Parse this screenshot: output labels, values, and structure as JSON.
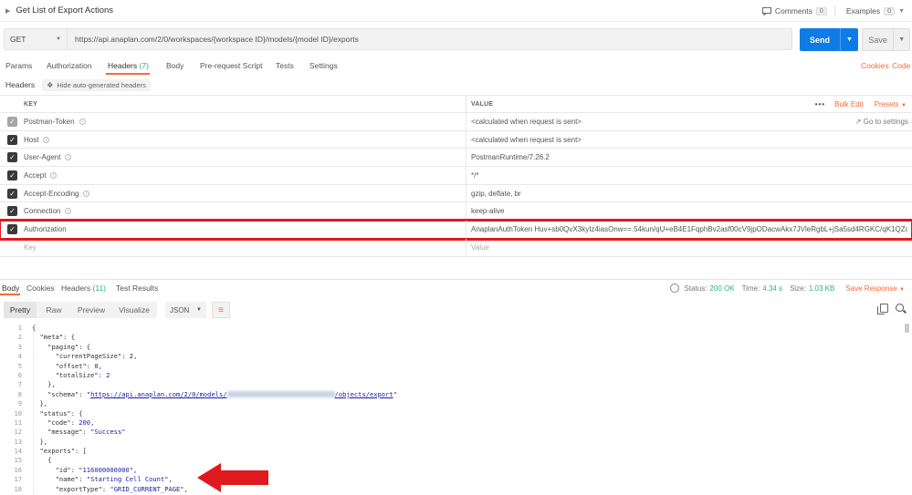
{
  "request": {
    "name": "Get List of Export Actions",
    "method": "GET",
    "url": "https://api.anaplan.com/2/0/workspaces/{workspace ID}/models/{model ID}/exports",
    "send_label": "Send",
    "save_label": "Save"
  },
  "topbar": {
    "comments_label": "Comments",
    "comments_count": "0",
    "examples_label": "Examples",
    "examples_count": "0"
  },
  "request_tabs": {
    "params": "Params",
    "authorization": "Authorization",
    "headers": "Headers",
    "headers_count": "(7)",
    "body": "Body",
    "prerequest": "Pre-request Script",
    "tests": "Tests",
    "settings": "Settings",
    "cookies": "Cookies",
    "code": "Code"
  },
  "headers_section": {
    "label": "Headers",
    "hide_auto": "Hide auto-generated headers",
    "key_col": "KEY",
    "value_col": "VALUE",
    "bulk_edit": "Bulk Edit",
    "presets": "Presets",
    "goto_settings": "Go to settings",
    "key_placeholder": "Key",
    "value_placeholder": "Value",
    "rows": [
      {
        "key": "Postman-Token",
        "value": "<calculated when request is sent>"
      },
      {
        "key": "Host",
        "value": "<calculated when request is sent>"
      },
      {
        "key": "User-Agent",
        "value": "PostmanRuntime/7.26.2"
      },
      {
        "key": "Accept",
        "value": "*/*"
      },
      {
        "key": "Accept-Encoding",
        "value": "gzip, deflate, br"
      },
      {
        "key": "Connection",
        "value": "keep-alive"
      },
      {
        "key": "Authorization",
        "value": "AnaplanAuthToken Huv+sb0QvX3kyIz4iasOnw==.54kun/qU+eB4E1FqphBv2asf00cV9jpODacwAkx7JVleRgbL+jSa5sd4RGKC/qK1QZoWnt"
      }
    ]
  },
  "response": {
    "tabs": {
      "body": "Body",
      "cookies": "Cookies",
      "headers": "Headers",
      "headers_count": "(11)",
      "test_results": "Test Results"
    },
    "status_label": "Status:",
    "status_value": "200 OK",
    "time_label": "Time:",
    "time_value": "4.34 s",
    "size_label": "Size:",
    "size_value": "1.03 KB",
    "save_response": "Save Response",
    "view_modes": [
      "Pretty",
      "Raw",
      "Preview",
      "Visualize"
    ],
    "format": "JSON"
  },
  "code_lines": [
    "{",
    "  \"meta\": {",
    "    \"paging\": {",
    "      \"currentPageSize\": 2,",
    "      \"offset\": 0,",
    "      \"totalSize\": 2",
    "    },",
    "    \"schema\": \"https://api.anaplan.com/2/0/models/[redacted]/objects/export\"",
    "  },",
    "  \"status\": {",
    "    \"code\": 200,",
    "    \"message\": \"Success\"",
    "  },",
    "  \"exports\": [",
    "    {",
    "      \"id\": \"116000000000\",",
    "      \"name\": \"Starting Cell Count\",",
    "      \"exportType\": \"GRID_CURRENT_PAGE\","
  ],
  "colors": {
    "accent": "#f26b3a",
    "send": "#0f7ce5",
    "success": "#26b47f",
    "highlight": "#e0191f"
  }
}
